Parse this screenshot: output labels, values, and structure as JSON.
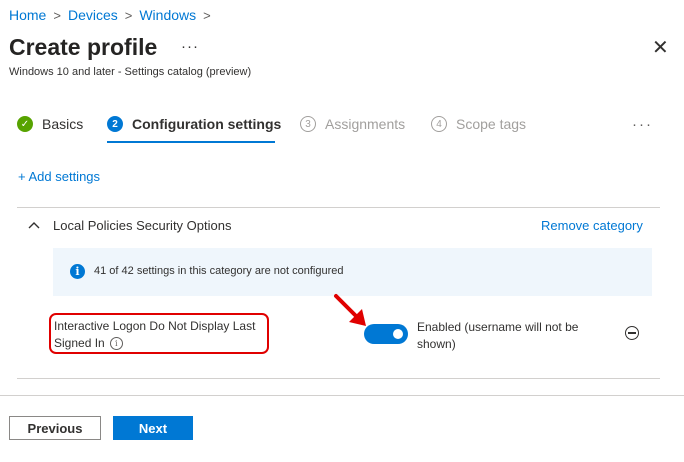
{
  "breadcrumb": {
    "items": [
      "Home",
      "Devices",
      "Windows"
    ]
  },
  "header": {
    "title": "Create profile",
    "more": "···",
    "subtitle": "Windows 10 and later - Settings catalog (preview)",
    "close": "✕"
  },
  "steps": [
    {
      "number": "✓",
      "label": "Basics",
      "state": "done"
    },
    {
      "number": "2",
      "label": "Configuration settings",
      "state": "current"
    },
    {
      "number": "3",
      "label": "Assignments",
      "state": "todo"
    },
    {
      "number": "4",
      "label": "Scope tags",
      "state": "todo"
    }
  ],
  "steps_more": "···",
  "add_settings": "+ Add settings",
  "category": {
    "title": "Local Policies Security Options",
    "remove": "Remove category",
    "info": "41 of 42 settings in this category are not configured",
    "info_icon": "i"
  },
  "setting": {
    "label": "Interactive Logon Do Not Display Last Signed In",
    "info_icon": "i",
    "toggle_on": true,
    "value_text": "Enabled (username will not be shown)"
  },
  "footer": {
    "previous": "Previous",
    "next": "Next"
  },
  "colors": {
    "accent": "#0078d4",
    "success": "#57a300",
    "highlight": "#e00000"
  }
}
